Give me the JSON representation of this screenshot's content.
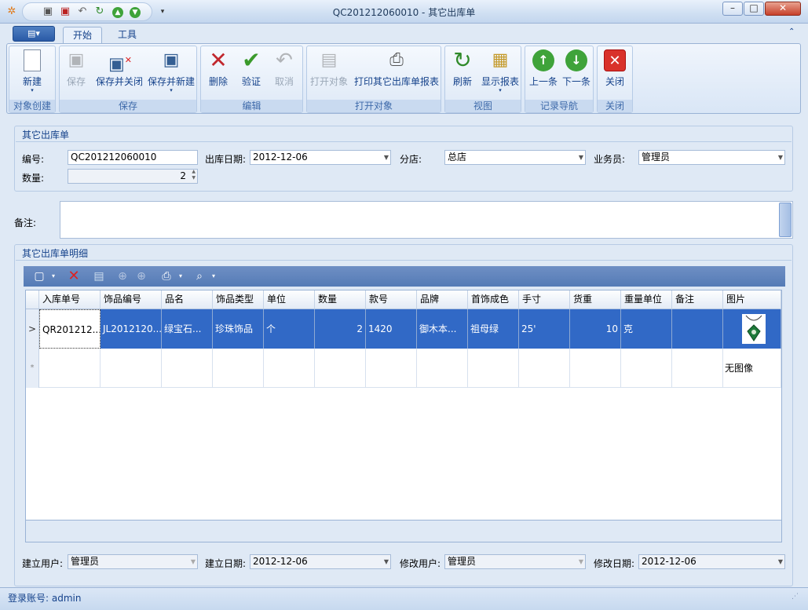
{
  "window": {
    "title": "QC201212060010 - 其它出库单",
    "minimize": "–",
    "maximize": "□",
    "close": "✕"
  },
  "quick_access": [
    "app-gear-icon",
    "save-icon",
    "save-close-icon",
    "undo-icon",
    "refresh-icon",
    "prev-icon",
    "next-icon",
    "customize-icon"
  ],
  "ribbon": {
    "app_menu_label": "▤▾",
    "tabs": [
      "开始",
      "工具"
    ],
    "groups": [
      {
        "caption": "对象创建",
        "buttons": [
          {
            "label": "新建",
            "enabled": true,
            "icon": "new-doc-icon"
          }
        ]
      },
      {
        "caption": "保存",
        "buttons": [
          {
            "label": "保存",
            "enabled": false,
            "icon": "save-icon"
          },
          {
            "label": "保存并关闭",
            "enabled": true,
            "icon": "save-close-icon"
          },
          {
            "label": "保存并新建",
            "enabled": true,
            "icon": "save-new-icon"
          }
        ]
      },
      {
        "caption": "编辑",
        "buttons": [
          {
            "label": "删除",
            "enabled": true,
            "icon": "delete-icon"
          },
          {
            "label": "验证",
            "enabled": true,
            "icon": "check-icon"
          },
          {
            "label": "取消",
            "enabled": false,
            "icon": "undo-icon"
          }
        ]
      },
      {
        "caption": "打开对象",
        "buttons": [
          {
            "label": "打开对象",
            "enabled": false,
            "icon": "open-object-icon"
          },
          {
            "label": "打印其它出库单报表",
            "enabled": true,
            "icon": "print-icon"
          }
        ]
      },
      {
        "caption": "视图",
        "buttons": [
          {
            "label": "刷新",
            "enabled": true,
            "icon": "refresh-icon"
          },
          {
            "label": "显示报表",
            "enabled": true,
            "icon": "report-icon"
          }
        ]
      },
      {
        "caption": "记录导航",
        "buttons": [
          {
            "label": "上一条",
            "enabled": true,
            "icon": "up-arrow-icon"
          },
          {
            "label": "下一条",
            "enabled": true,
            "icon": "down-arrow-icon"
          }
        ]
      },
      {
        "caption": "关闭",
        "buttons": [
          {
            "label": "关闭",
            "enabled": true,
            "icon": "close-icon"
          }
        ]
      }
    ]
  },
  "form": {
    "section_title": "其它出库单",
    "code_label": "编号:",
    "code_value": "QC201212060010",
    "date_label": "出库日期:",
    "date_value": "2012-12-06",
    "store_label": "分店:",
    "store_value": "总店",
    "clerk_label": "业务员:",
    "clerk_value": "管理员",
    "qty_label": "数量:",
    "qty_value": "2",
    "note_label": "备注:",
    "note_value": ""
  },
  "detail": {
    "section_title": "其它出库单明细",
    "columns": [
      "入库单号",
      "饰品编号",
      "品名",
      "饰品类型",
      "单位",
      "数量",
      "款号",
      "品牌",
      "首饰成色",
      "手寸",
      "货重",
      "重量单位",
      "备注",
      "图片"
    ],
    "rows": [
      [
        "QR201212...",
        "JL2012120...",
        "绿宝石...",
        "珍珠饰品",
        "个",
        "2",
        "1420",
        "御木本...",
        "祖母绿",
        "25'",
        "10",
        "克",
        "",
        ""
      ]
    ],
    "new_row_image_text": "无图像",
    "row_indicator": ">",
    "new_row_indicator": "*"
  },
  "footer": {
    "created_by_label": "建立用户:",
    "created_by": "管理员",
    "created_date_label": "建立日期:",
    "created_date": "2012-12-06",
    "modified_by_label": "修改用户:",
    "modified_by": "管理员",
    "modified_date_label": "修改日期:",
    "modified_date": "2012-12-06"
  },
  "status": {
    "login": "登录账号: admin"
  },
  "colors": {
    "selection": "#3169c6",
    "accent": "#15428b"
  }
}
